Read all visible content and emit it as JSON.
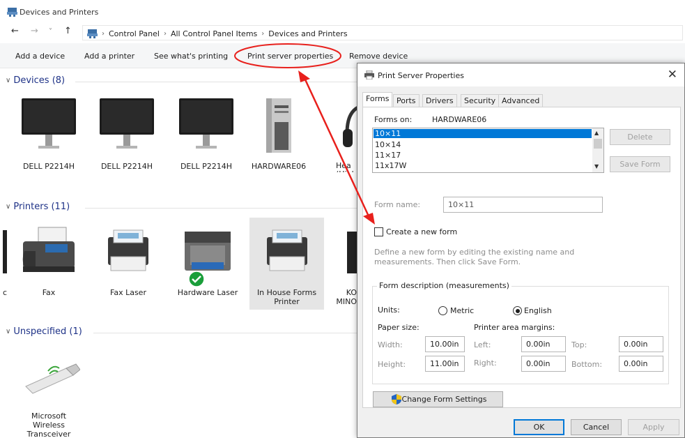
{
  "window": {
    "title": "Devices and Printers"
  },
  "nav": {
    "back": "←",
    "forward": "→",
    "recent": "˅",
    "up": "↑"
  },
  "breadcrumb": [
    "Control Panel",
    "All Control Panel Items",
    "Devices and Printers"
  ],
  "toolbar": {
    "add_device": "Add a device",
    "add_printer": "Add a printer",
    "see_printing": "See what's printing",
    "print_server": "Print server properties",
    "remove_device": "Remove device"
  },
  "groups": {
    "devices": "Devices (8)",
    "printers": "Printers (11)",
    "unspecified": "Unspecified (1)"
  },
  "devices": [
    "DELL P2214H",
    "DELL P2214H",
    "DELL P2214H",
    "HARDWARE06",
    "Hea\n(High\nAud"
  ],
  "printers": [
    "Fax",
    "Fax Laser",
    "Hardware Laser",
    "In House Forms\nPrinter",
    "KO\nMINO"
  ],
  "unspecified": [
    "Microsoft\nWireless\nTransceiver"
  ],
  "dialog": {
    "title": "Print Server Properties",
    "tabs": [
      "Forms",
      "Ports",
      "Drivers",
      "Security",
      "Advanced"
    ],
    "forms_on_label": "Forms on:",
    "forms_on_value": "HARDWARE06",
    "forms_list": [
      "10×11",
      "10×14",
      "11×17",
      "11x17W"
    ],
    "delete_btn": "Delete",
    "save_form_btn": "Save Form",
    "form_name_label": "Form name:",
    "form_name_value": "10×11",
    "create_new_form": "Create a new form",
    "define_help": "Define a new form by editing the existing name and measurements. Then click Save Form.",
    "form_desc_legend": "Form description (measurements)",
    "units_label": "Units:",
    "metric": "Metric",
    "english": "English",
    "paper_size": "Paper size:",
    "printer_margins": "Printer area margins:",
    "width_label": "Width:",
    "width_value": "10.00in",
    "height_label": "Height:",
    "height_value": "11.00in",
    "left_label": "Left:",
    "left_value": "0.00in",
    "right_label": "Right:",
    "right_value": "0.00in",
    "top_label": "Top:",
    "top_value": "0.00in",
    "bottom_label": "Bottom:",
    "bottom_value": "0.00in",
    "change_settings": "Change Form Settings",
    "ok": "OK",
    "cancel": "Cancel",
    "apply": "Apply"
  },
  "annotation_color": "#e8201c"
}
